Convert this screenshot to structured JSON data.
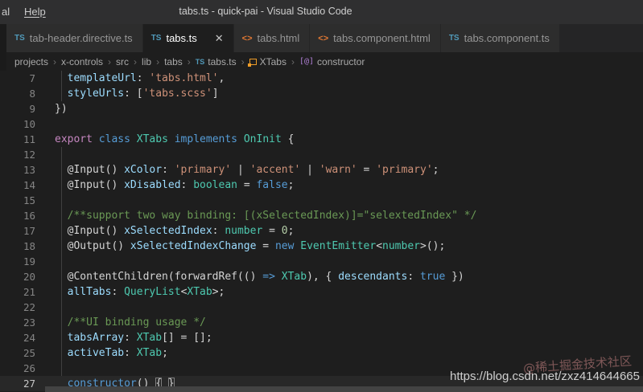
{
  "title_bar": {
    "menu_left_partial": "al",
    "menu_help": "Help",
    "title": "tabs.ts - quick-pai - Visual Studio Code"
  },
  "tab_bar": {
    "close_icon": "✕",
    "ts_icon_text": "TS",
    "html_icon_text": "<>",
    "tabs": [
      {
        "label": "tab-header.directive.ts",
        "icon": "ts",
        "active": false
      },
      {
        "label": "tabs.ts",
        "icon": "ts",
        "active": true
      },
      {
        "label": "tabs.html",
        "icon": "html",
        "active": false
      },
      {
        "label": "tabs.component.html",
        "icon": "html",
        "active": false
      },
      {
        "label": "tabs.component.ts",
        "icon": "ts",
        "active": false
      }
    ]
  },
  "breadcrumb": {
    "separator": "›",
    "items": [
      {
        "label": "projects"
      },
      {
        "label": "x-controls"
      },
      {
        "label": "src"
      },
      {
        "label": "lib"
      },
      {
        "label": "tabs"
      },
      {
        "label": "tabs.ts",
        "icon": "ts"
      },
      {
        "label": "XTabs",
        "icon": "class"
      },
      {
        "label": "constructor",
        "icon": "method"
      }
    ],
    "method_icon_text": "[@]",
    "ts_icon_text": "TS"
  },
  "editor": {
    "current_line": 27,
    "lines": [
      {
        "n": 7,
        "tokens": [
          [
            "pl",
            "  "
          ],
          [
            "prop",
            "templateUrl"
          ],
          [
            "pl",
            ": "
          ],
          [
            "str",
            "'tabs.html'"
          ],
          [
            "pl",
            ","
          ]
        ]
      },
      {
        "n": 8,
        "tokens": [
          [
            "pl",
            "  "
          ],
          [
            "prop",
            "styleUrls"
          ],
          [
            "pl",
            ": ["
          ],
          [
            "str",
            "'tabs.scss'"
          ],
          [
            "pl",
            "]"
          ]
        ]
      },
      {
        "n": 9,
        "tokens": [
          [
            "pl",
            "})"
          ]
        ]
      },
      {
        "n": 10,
        "tokens": []
      },
      {
        "n": 11,
        "tokens": [
          [
            "ctrl",
            "export"
          ],
          [
            "pl",
            " "
          ],
          [
            "kw",
            "class"
          ],
          [
            "pl",
            " "
          ],
          [
            "type",
            "XTabs"
          ],
          [
            "pl",
            " "
          ],
          [
            "kw",
            "implements"
          ],
          [
            "pl",
            " "
          ],
          [
            "type",
            "OnInit"
          ],
          [
            "pl",
            " {"
          ]
        ]
      },
      {
        "n": 12,
        "tokens": []
      },
      {
        "n": 13,
        "tokens": [
          [
            "pl",
            "  @Input() "
          ],
          [
            "prop",
            "xColor"
          ],
          [
            "pl",
            ": "
          ],
          [
            "str",
            "'primary'"
          ],
          [
            "pl",
            " | "
          ],
          [
            "str",
            "'accent'"
          ],
          [
            "pl",
            " | "
          ],
          [
            "str",
            "'warn'"
          ],
          [
            "pl",
            " = "
          ],
          [
            "str",
            "'primary'"
          ],
          [
            "pl",
            ";"
          ]
        ]
      },
      {
        "n": 14,
        "tokens": [
          [
            "pl",
            "  @Input() "
          ],
          [
            "prop",
            "xDisabled"
          ],
          [
            "pl",
            ": "
          ],
          [
            "type",
            "boolean"
          ],
          [
            "pl",
            " = "
          ],
          [
            "kw",
            "false"
          ],
          [
            "pl",
            ";"
          ]
        ]
      },
      {
        "n": 15,
        "tokens": []
      },
      {
        "n": 16,
        "tokens": [
          [
            "pl",
            "  "
          ],
          [
            "cmt",
            "/**support two way binding: [(xSelectedIndex)]=\"selextedIndex\" */"
          ]
        ]
      },
      {
        "n": 17,
        "tokens": [
          [
            "pl",
            "  @Input() "
          ],
          [
            "prop",
            "xSelectedIndex"
          ],
          [
            "pl",
            ": "
          ],
          [
            "type",
            "number"
          ],
          [
            "pl",
            " = "
          ],
          [
            "num",
            "0"
          ],
          [
            "pl",
            ";"
          ]
        ]
      },
      {
        "n": 18,
        "tokens": [
          [
            "pl",
            "  @Output() "
          ],
          [
            "prop",
            "xSelectedIndexChange"
          ],
          [
            "pl",
            " = "
          ],
          [
            "kw",
            "new"
          ],
          [
            "pl",
            " "
          ],
          [
            "type",
            "EventEmitter"
          ],
          [
            "pl",
            "<"
          ],
          [
            "type",
            "number"
          ],
          [
            "pl",
            ">();"
          ]
        ]
      },
      {
        "n": 19,
        "tokens": []
      },
      {
        "n": 20,
        "tokens": [
          [
            "pl",
            "  @ContentChildren(forwardRef(() "
          ],
          [
            "kw",
            "=>"
          ],
          [
            "pl",
            " "
          ],
          [
            "type",
            "XTab"
          ],
          [
            "pl",
            "), { "
          ],
          [
            "prop",
            "descendants"
          ],
          [
            "pl",
            ": "
          ],
          [
            "kw",
            "true"
          ],
          [
            "pl",
            " })"
          ]
        ]
      },
      {
        "n": 21,
        "tokens": [
          [
            "pl",
            "  "
          ],
          [
            "prop",
            "allTabs"
          ],
          [
            "pl",
            ": "
          ],
          [
            "type",
            "QueryList"
          ],
          [
            "pl",
            "<"
          ],
          [
            "type",
            "XTab"
          ],
          [
            "pl",
            ">;"
          ]
        ]
      },
      {
        "n": 22,
        "tokens": []
      },
      {
        "n": 23,
        "tokens": [
          [
            "pl",
            "  "
          ],
          [
            "cmt",
            "/**UI binding usage */"
          ]
        ]
      },
      {
        "n": 24,
        "tokens": [
          [
            "pl",
            "  "
          ],
          [
            "prop",
            "tabsArray"
          ],
          [
            "pl",
            ": "
          ],
          [
            "type",
            "XTab"
          ],
          [
            "pl",
            "[] = [];"
          ]
        ]
      },
      {
        "n": 25,
        "tokens": [
          [
            "pl",
            "  "
          ],
          [
            "prop",
            "activeTab"
          ],
          [
            "pl",
            ": "
          ],
          [
            "type",
            "XTab"
          ],
          [
            "pl",
            ";"
          ]
        ]
      },
      {
        "n": 26,
        "tokens": []
      },
      {
        "n": 27,
        "tokens": [
          [
            "pl",
            "  "
          ],
          [
            "kw",
            "constructor"
          ],
          [
            "pl",
            "() "
          ],
          [
            "brkt",
            "{"
          ],
          [
            "pl",
            " "
          ],
          [
            "brkt",
            "}"
          ]
        ]
      }
    ]
  },
  "watermarks": {
    "url": "https://blog.csdn.net/zxz414644665",
    "juejin": "@稀土掘金技术社区"
  },
  "colors": {
    "editor_bg": "#1e1e1e",
    "tabbar_bg": "#252526",
    "inactive_tab_bg": "#2d2d2d",
    "ts_icon": "#519aba",
    "html_icon": "#e37933",
    "keyword": "#569CD6",
    "control": "#C586C0",
    "type": "#4EC9B0",
    "property": "#9CDCFE",
    "string": "#CE9178",
    "comment": "#6A9955",
    "number": "#B5CEA8",
    "plain": "#D4D4D4"
  }
}
